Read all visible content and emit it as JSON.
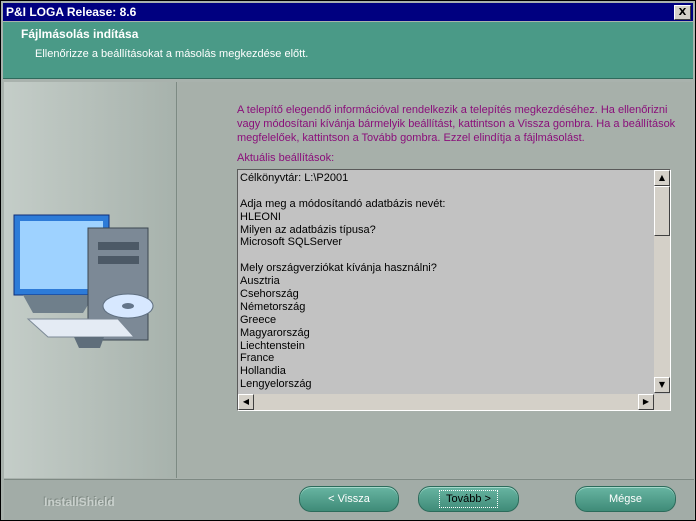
{
  "window": {
    "title": "P&I LOGA  Release: 8.6",
    "close_label": "X"
  },
  "header": {
    "title": "Fájlmásolás indítása",
    "subtitle": "Ellenőrizze a beállításokat a másolás megkezdése előtt."
  },
  "main": {
    "intro": "A telepítő elegendő információval rendelkezik a telepítés megkezdéséhez. Ha ellenőrizni vagy módosítani kívánja bármelyik beállítást, kattintson a Vissza gombra. Ha a beállítások megfelelőek, kattintson a Tovább gombra. Ezzel elindítja a fájlmásolást.",
    "settings_label": "Aktuális beállítások:",
    "settings_lines": [
      "Célkönyvtár: L:\\P2001",
      "",
      "Adja meg a módosítandó adatbázis nevét:",
      "HLEONI",
      "Milyen az adatbázis típusa?",
      "Microsoft SQLServer",
      "",
      "Mely országverziókat kívánja használni?",
      "Ausztria",
      "Csehország",
      "Németország",
      "Greece",
      "Magyarország",
      "Liechtenstein",
      "France",
      "Hollandia",
      "Lengyelország"
    ]
  },
  "footer": {
    "brand": "InstallShield",
    "back": "< Vissza",
    "next": "Tovább >",
    "cancel": "Mégse"
  },
  "colors": {
    "title_bar": "#000080",
    "header_band": "#4a9a87",
    "accent_text": "#8a0f7a"
  }
}
